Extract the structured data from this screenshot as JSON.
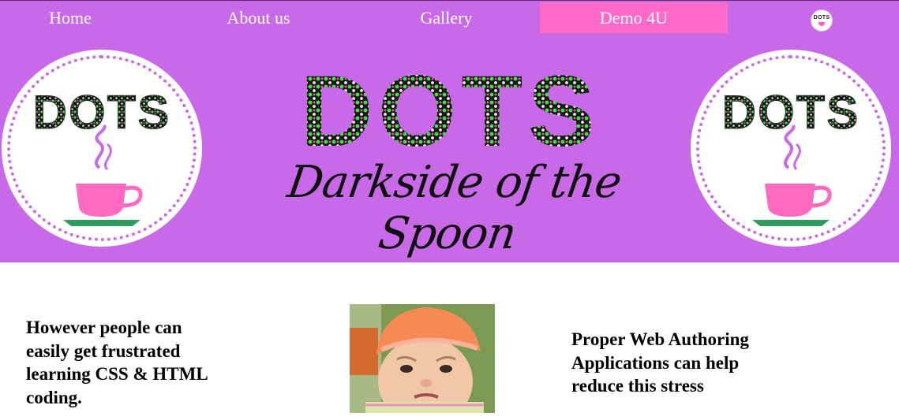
{
  "nav": {
    "items": [
      {
        "label": "Home"
      },
      {
        "label": "About us"
      },
      {
        "label": "Gallery"
      },
      {
        "label": "Demo 4U"
      }
    ],
    "logo_text": "DOTS",
    "active_color": "#ff69c8"
  },
  "header": {
    "logo_text": "DOTS",
    "title_big": "DOTS",
    "title_script": "Darkside of the Spoon",
    "background_color": "#c86ae8"
  },
  "content": {
    "left_text": "However people can easily get frustrated learning CSS & HTML coding.",
    "right_text": "Proper Web Authoring Applications can help reduce this stress",
    "photo_alt": "grumpy baby"
  }
}
